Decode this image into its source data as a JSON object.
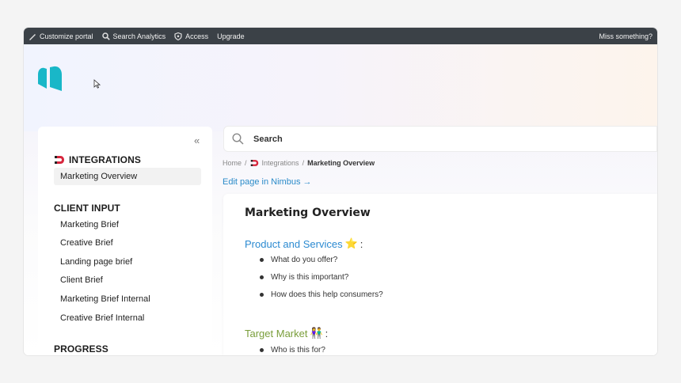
{
  "adminbar": {
    "customize": "Customize portal",
    "search_analytics": "Search Analytics",
    "access": "Access",
    "upgrade": "Upgrade",
    "miss": "Miss something?"
  },
  "sidebar": {
    "sections": [
      {
        "title": "INTEGRATIONS",
        "items": [
          "Marketing Overview"
        ]
      },
      {
        "title": "CLIENT INPUT",
        "items": [
          "Marketing Brief",
          "Creative Brief",
          "Landing page brief",
          "Client Brief",
          "Marketing Brief Internal",
          "Creative Brief Internal"
        ]
      },
      {
        "title": "PROGRESS",
        "items": []
      }
    ]
  },
  "search": {
    "placeholder": "Search"
  },
  "breadcrumb": {
    "home": "Home",
    "sep": "/",
    "integrations": "Integrations",
    "current": "Marketing Overview"
  },
  "edit_link": "Edit page in Nimbus →",
  "page": {
    "title": "Marketing Overview",
    "sections": [
      {
        "heading": "Product and Services",
        "emoji": "⭐",
        "colon": ":",
        "bullets": [
          "What do you offer?",
          "Why is this important?",
          "How does this help consumers?"
        ]
      },
      {
        "heading": "Target Market",
        "emoji": "👫",
        "colon": ":",
        "bullets": [
          "Who is this for?"
        ]
      }
    ]
  },
  "colors": {
    "accent": "#2a8bc9",
    "green_heading": "#7a9e3b",
    "logo": "#19b7c8",
    "adminbar": "#3b4147"
  }
}
